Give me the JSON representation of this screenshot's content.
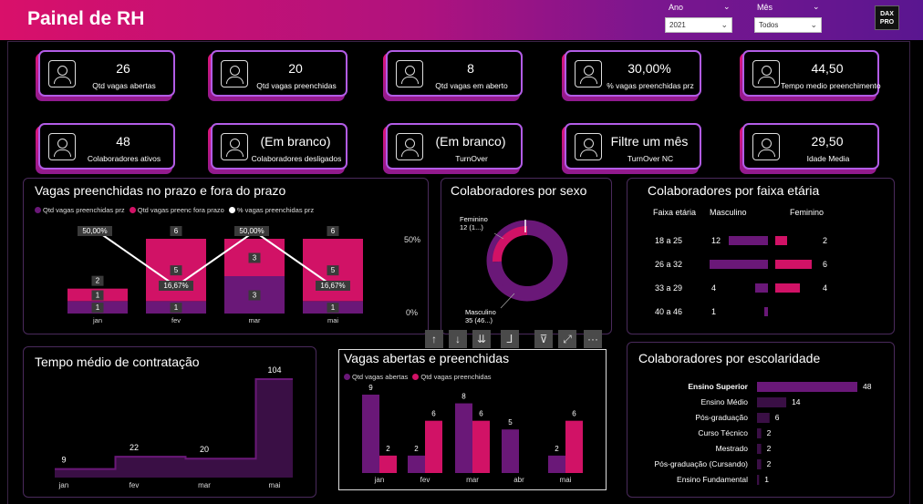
{
  "header": {
    "title": "Painel de RH",
    "year_label": "Ano",
    "year_value": "2021",
    "month_label": "Mês",
    "month_value": "Todos",
    "logo_line1": "DAX",
    "logo_line2": "PRO"
  },
  "kpis": [
    {
      "value": "26",
      "label": "Qtd vagas abertas",
      "icon": "job-posting-icon"
    },
    {
      "value": "20",
      "label": "Qtd vagas preenchidas",
      "icon": "filled-job-icon"
    },
    {
      "value": "8",
      "label": "Qtd vagas em aberto",
      "icon": "team-icon"
    },
    {
      "value": "30,00%",
      "label": "% vagas preenchidas prz",
      "icon": "percent-icon"
    },
    {
      "value": "44,50",
      "label": "Tempo medio preenchimento",
      "icon": "timer-icon"
    },
    {
      "value": "48",
      "label": "Colaboradores ativos",
      "icon": "people-icon"
    },
    {
      "value": "(Em branco)",
      "label": "Colaboradores desligados",
      "icon": "person-off-icon"
    },
    {
      "value": "(Em branco)",
      "label": "TurnOver",
      "icon": "turnover-icon"
    },
    {
      "value": "Filtre um mês",
      "label": "TurnOver NC",
      "icon": "calendar-icon"
    },
    {
      "value": "29,50",
      "label": "Idade Media",
      "icon": "id-card-icon"
    }
  ],
  "colors": {
    "purple": "#6a1878",
    "pink": "#d11266",
    "dark_purple": "#3a0f45",
    "accent_border": "#b25ce6"
  },
  "prazo_chart": {
    "title": "Vagas preenchidas no prazo e fora do prazo",
    "legend": [
      "Qtd vagas preenchidas prz",
      "Qtd vagas preenc fora prazo",
      "% vagas preenchidas prz"
    ],
    "axis_right": [
      "50%",
      "0%"
    ]
  },
  "sexo_chart": {
    "title": "Colaboradores por sexo",
    "label_fem_name": "Feminino",
    "label_fem_value": "12 (1...)",
    "label_masc_name": "Masculino",
    "label_masc_value": "35 (46...)"
  },
  "faixa_table": {
    "title": "Colaboradores por faixa etária",
    "headers": [
      "Faixa etária",
      "Masculino",
      "Feminino"
    ],
    "rows": [
      {
        "faixa": "18 a 25",
        "masc": "12",
        "fem": "2"
      },
      {
        "faixa": "26 a 32",
        "masc": "18",
        "fem": "6"
      },
      {
        "faixa": "33 a 29",
        "masc": "4",
        "fem": "4"
      },
      {
        "faixa": "40 a 46",
        "masc": "1",
        "fem": ""
      }
    ]
  },
  "tempo_chart": {
    "title": "Tempo médio de contratação"
  },
  "abertas_chart": {
    "title": "Vagas abertas e preenchidas",
    "legend": [
      "Qtd vagas abertas",
      "Qtd vagas preenchidas"
    ]
  },
  "escolaridade_chart": {
    "title": "Colaboradores por escolaridade"
  },
  "chart_data": [
    {
      "type": "bar",
      "title": "Vagas preenchidas no prazo e fora do prazo",
      "categories": [
        "jan",
        "fev",
        "mar",
        "mai"
      ],
      "series": [
        {
          "name": "Qtd vagas preenchidas prz",
          "values": [
            1,
            1,
            3,
            1
          ]
        },
        {
          "name": "Qtd vagas preenc fora prazo",
          "values": [
            1,
            5,
            3,
            5
          ]
        },
        {
          "name": "% vagas preenchidas prz",
          "values": [
            50.0,
            16.67,
            50.0,
            16.67
          ],
          "display": [
            "50,00%",
            "16,67%",
            "50,00%",
            "16,67%"
          ]
        }
      ],
      "totals": [
        2,
        6,
        6,
        6
      ]
    },
    {
      "type": "pie",
      "title": "Colaboradores por sexo",
      "categories": [
        "Masculino",
        "Feminino"
      ],
      "values": [
        35,
        12
      ]
    },
    {
      "type": "bar",
      "title": "Colaboradores por faixa etária",
      "categories": [
        "18 a 25",
        "26 a 32",
        "33 a 29",
        "40 a 46"
      ],
      "series": [
        {
          "name": "Masculino",
          "values": [
            12,
            18,
            4,
            1
          ]
        },
        {
          "name": "Feminino",
          "values": [
            2,
            6,
            4,
            0
          ]
        }
      ]
    },
    {
      "type": "area",
      "title": "Tempo médio de contratação",
      "categories": [
        "jan",
        "fev",
        "mar",
        "mai"
      ],
      "values": [
        9,
        22,
        20,
        104
      ]
    },
    {
      "type": "bar",
      "title": "Vagas abertas e preenchidas",
      "categories": [
        "jan",
        "fev",
        "mar",
        "abr",
        "mai"
      ],
      "series": [
        {
          "name": "Qtd vagas abertas",
          "values": [
            9,
            2,
            8,
            5,
            2
          ]
        },
        {
          "name": "Qtd vagas preenchidas",
          "values": [
            2,
            6,
            6,
            null,
            6
          ]
        }
      ]
    },
    {
      "type": "bar",
      "title": "Colaboradores por escolaridade",
      "categories": [
        "Ensino Superior",
        "Ensino Médio",
        "Pós-graduação",
        "Curso Técnico",
        "Mestrado",
        "Pós-graduação (Cursando)",
        "Ensino Fundamental"
      ],
      "values": [
        48,
        14,
        6,
        2,
        2,
        2,
        1
      ]
    }
  ]
}
